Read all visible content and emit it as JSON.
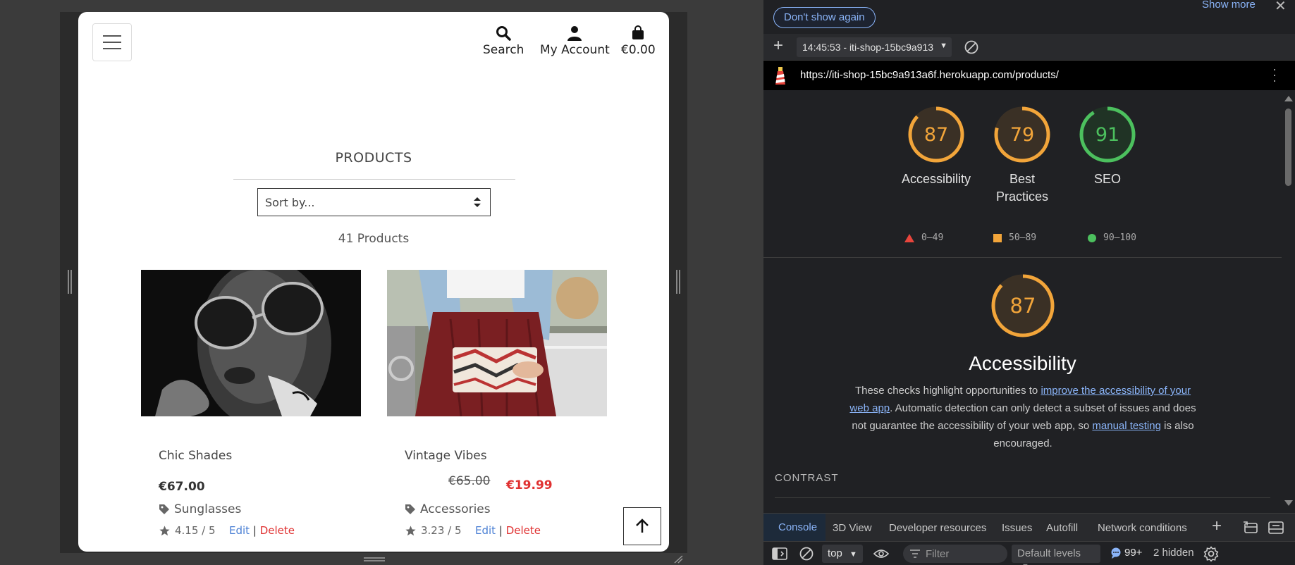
{
  "site": {
    "nav": {
      "search_label": "Search",
      "account_label": "My Account",
      "bag_total": "€0.00"
    },
    "page_title": "PRODUCTS",
    "sort_placeholder": "Sort by...",
    "products_count": "41 Products",
    "products": [
      {
        "name": "Chic Shades",
        "price": "€67.00",
        "category": "Sunglasses",
        "rating": "4.15 / 5",
        "edit_label": "Edit",
        "separator": "|",
        "delete_label": "Delete"
      },
      {
        "name": "Vintage Vibes",
        "old_price": "€65.00",
        "sale_price": "€19.99",
        "category": "Accessories",
        "rating": "3.23 / 5",
        "edit_label": "Edit",
        "separator": "|",
        "delete_label": "Delete"
      }
    ]
  },
  "devtools": {
    "dont_show_again": "Don't show again",
    "show_more": "Show more",
    "report_selector": "14:45:53 - iti-shop-15bc9a913",
    "report_url": "https://iti-shop-15bc9a913a6f.herokuapp.com/products/",
    "scores": [
      {
        "label": "Accessibility",
        "value": "87",
        "score": 87,
        "color": "#f2a53a"
      },
      {
        "label": "Best Practices",
        "value": "79",
        "score": 79,
        "color": "#f2a53a"
      },
      {
        "label": "SEO",
        "value": "91",
        "score": 91,
        "color": "#4cc05e"
      }
    ],
    "legend": {
      "fail": "0–49",
      "average": "50–89",
      "pass": "90–100"
    },
    "category": {
      "score": "87",
      "score_value": 87,
      "title": "Accessibility",
      "desc_1": "These checks highlight opportunities to ",
      "desc_link_1": "improve the accessibility of your web app",
      "desc_2": ". Automatic detection can only detect a subset of issues and does not guarantee the accessibility of your web app, so ",
      "desc_link_2": "manual testing",
      "desc_3": " is also encouraged.",
      "section_heading": "CONTRAST"
    },
    "drawer_tabs": [
      "Console",
      "3D View",
      "Developer resources",
      "Issues",
      "Autofill",
      "Network conditions"
    ],
    "console_toolbar": {
      "context": "top",
      "filter_placeholder": "Filter",
      "levels": "Default levels",
      "issues_count": "99+",
      "hidden": "2 hidden"
    },
    "colors": {
      "average": "#f2a53a",
      "pass": "#4cc05e",
      "fail": "#e8453c",
      "link": "#8ab4f8"
    }
  }
}
